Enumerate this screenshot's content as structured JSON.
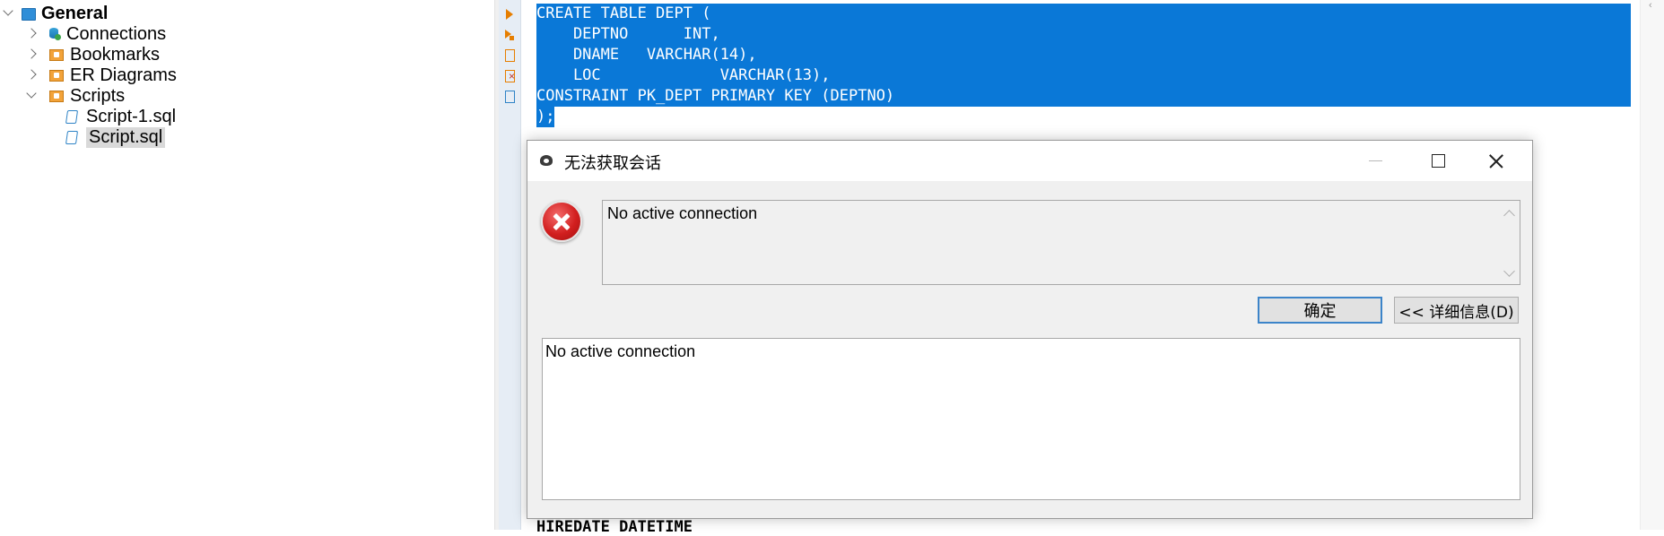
{
  "navigator": {
    "root": {
      "label": "General"
    },
    "items": [
      {
        "label": "Connections",
        "icon": "database-icon"
      },
      {
        "label": "Bookmarks",
        "icon": "bookmark-folder-icon"
      },
      {
        "label": "ER Diagrams",
        "icon": "er-folder-icon"
      },
      {
        "label": "Scripts",
        "icon": "scripts-folder-icon"
      }
    ],
    "scripts": [
      {
        "label": "Script-1.sql",
        "icon": "sql-script-icon"
      },
      {
        "label": "Script.sql",
        "icon": "sql-script-icon",
        "selected": true
      }
    ]
  },
  "editor": {
    "lines": [
      "CREATE TABLE DEPT (",
      "    DEPTNO      INT,",
      "    DNAME   VARCHAR(14),",
      "    LOC             VARCHAR(13),",
      "CONSTRAINT PK_DEPT PRIMARY KEY (DEPTNO)",
      ");"
    ],
    "tail_line": "HIREDATE DATETIME",
    "gutter_icons": [
      "execute-statement-icon",
      "execute-script-icon",
      "explain-plan-icon",
      "load-plan-icon",
      "export-icon"
    ]
  },
  "dialog": {
    "title": "无法获取会话",
    "message": "No active connection",
    "ok_label": "确定",
    "details_label": "<< 详细信息(D)",
    "details_text": "No active connection"
  },
  "colors": {
    "selection": "#0a78d7",
    "error": "#d21f1f",
    "accent_orange": "#e67e00"
  }
}
